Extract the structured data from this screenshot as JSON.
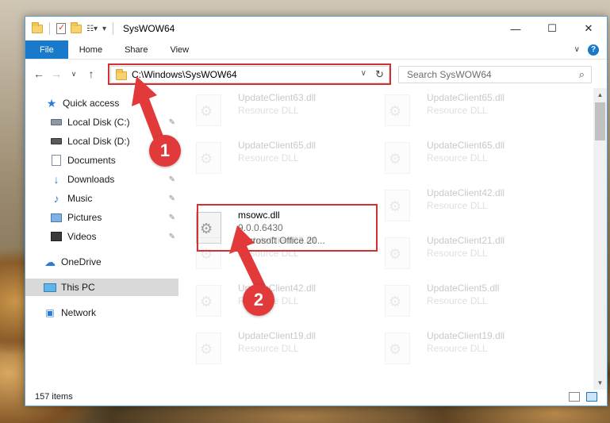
{
  "window": {
    "title": "SysWOW64",
    "minimize_glyph": "—",
    "maximize_glyph": "☐",
    "close_glyph": "✕"
  },
  "ribbon": {
    "tabs": [
      "File",
      "Home",
      "Share",
      "View"
    ],
    "help_glyph": "?",
    "expand_glyph": "∨"
  },
  "nav": {
    "back_glyph": "←",
    "forward_glyph": "→",
    "recent_glyph": "∨",
    "up_glyph": "↑",
    "address": "C:\\Windows\\SysWOW64",
    "address_dropdown_glyph": "∨",
    "refresh_glyph": "↻",
    "search_placeholder": "Search SysWOW64",
    "search_glyph": "⌕"
  },
  "sidebar": {
    "items": [
      {
        "label": "Quick access",
        "icon": "star-icon",
        "pinned": false
      },
      {
        "label": "Local Disk (C:)",
        "icon": "disk-icon",
        "pinned": true
      },
      {
        "label": "Local Disk (D:)",
        "icon": "disk-icon",
        "pinned": true
      },
      {
        "label": "Documents",
        "icon": "document-icon",
        "pinned": true
      },
      {
        "label": "Downloads",
        "icon": "download-icon",
        "pinned": true
      },
      {
        "label": "Music",
        "icon": "music-icon",
        "pinned": true
      },
      {
        "label": "Pictures",
        "icon": "picture-icon",
        "pinned": true
      },
      {
        "label": "Videos",
        "icon": "video-icon",
        "pinned": true
      },
      {
        "label": "OneDrive",
        "icon": "cloud-icon",
        "pinned": false
      },
      {
        "label": "This PC",
        "icon": "computer-icon",
        "pinned": false
      },
      {
        "label": "Network",
        "icon": "network-icon",
        "pinned": false
      }
    ],
    "pin_glyph": "📌"
  },
  "files": [
    {
      "name": "UpdateClient63.dll",
      "line2": "Resource DLL",
      "line3": "",
      "faded": true
    },
    {
      "name": "UpdateClient65.dll",
      "line2": "Resource DLL",
      "line3": "",
      "faded": true
    },
    {
      "name": "UpdateClient65.dll",
      "line2": "Resource DLL",
      "line3": "",
      "faded": true
    },
    {
      "name": "UpdateClient65.dll",
      "line2": "Resource DLL",
      "line3": "",
      "faded": true
    },
    {
      "name": "msowc.dll",
      "line2": "9.0.0.6430",
      "line3": "Microsoft Office 20...",
      "faded": false
    },
    {
      "name": "UpdateClient42.dll",
      "line2": "Resource DLL",
      "line3": "",
      "faded": true
    },
    {
      "name": "UpdateClient63.dll",
      "line2": "Resource DLL",
      "line3": "",
      "faded": true
    },
    {
      "name": "UpdateClient21.dll",
      "line2": "Resource DLL",
      "line3": "",
      "faded": true
    },
    {
      "name": "UpdateClient42.dll",
      "line2": "Resource DLL",
      "line3": "",
      "faded": true
    },
    {
      "name": "UpdateClient5.dll",
      "line2": "Resource DLL",
      "line3": "",
      "faded": true
    },
    {
      "name": "UpdateClient19.dll",
      "line2": "Resource DLL",
      "line3": "",
      "faded": true
    },
    {
      "name": "UpdateClient19.dll",
      "line2": "Resource DLL",
      "line3": "",
      "faded": true
    }
  ],
  "annotations": {
    "badge1": "1",
    "badge2": "2",
    "color": "#e23a3a"
  },
  "status": {
    "item_count": "157 items"
  },
  "colors": {
    "accent": "#1979ca",
    "highlight": "#d33131"
  }
}
